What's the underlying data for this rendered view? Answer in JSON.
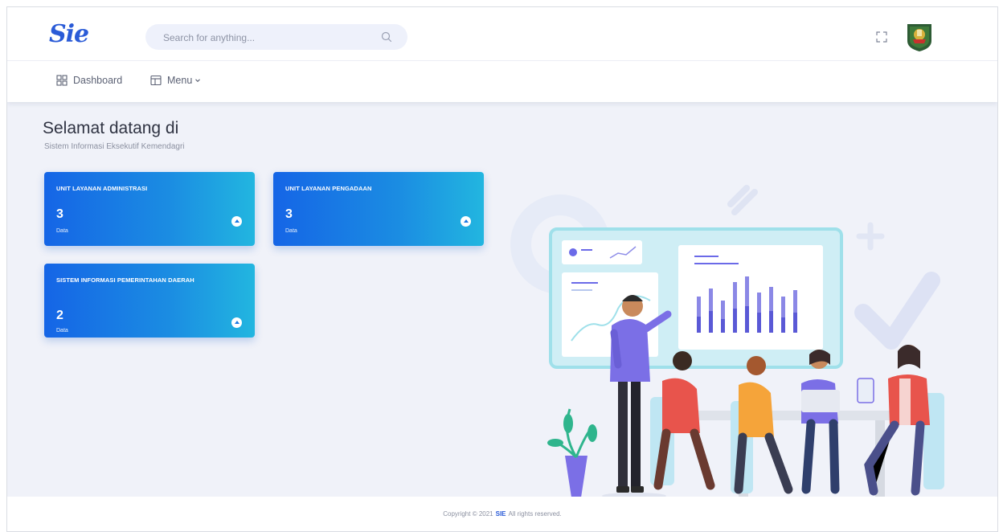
{
  "header": {
    "logo": "Sie",
    "search": {
      "placeholder": "Search for anything..."
    }
  },
  "nav": {
    "dashboard_label": "Dashboard",
    "menu_label": "Menu"
  },
  "main": {
    "title": "Selamat datang di",
    "subtitle": "Sistem Informasi Eksekutif Kemendagri",
    "cards": [
      {
        "title": "UNIT LAYANAN ADMINISTRASI",
        "count": "3",
        "unit": "Data"
      },
      {
        "title": "UNIT LAYANAN PENGADAAN",
        "count": "3",
        "unit": "Data"
      },
      {
        "title": "SISTEM INFORMASI PEMERINTAHAN DAERAH",
        "count": "2",
        "unit": "Data"
      }
    ]
  },
  "footer": {
    "prefix": "Copyright © 2021",
    "brand": "SIE",
    "suffix": "All rights reserved."
  },
  "colors": {
    "brand": "#2a5bd7",
    "card_gradient_start": "#1565e6",
    "card_gradient_end": "#22b6e0",
    "page_background": "#f0f2f9"
  },
  "icons": [
    "search-icon",
    "fullscreen-icon",
    "dashboard-icon",
    "menu-icon",
    "chevron-down-icon",
    "arrow-up-circle-icon"
  ]
}
